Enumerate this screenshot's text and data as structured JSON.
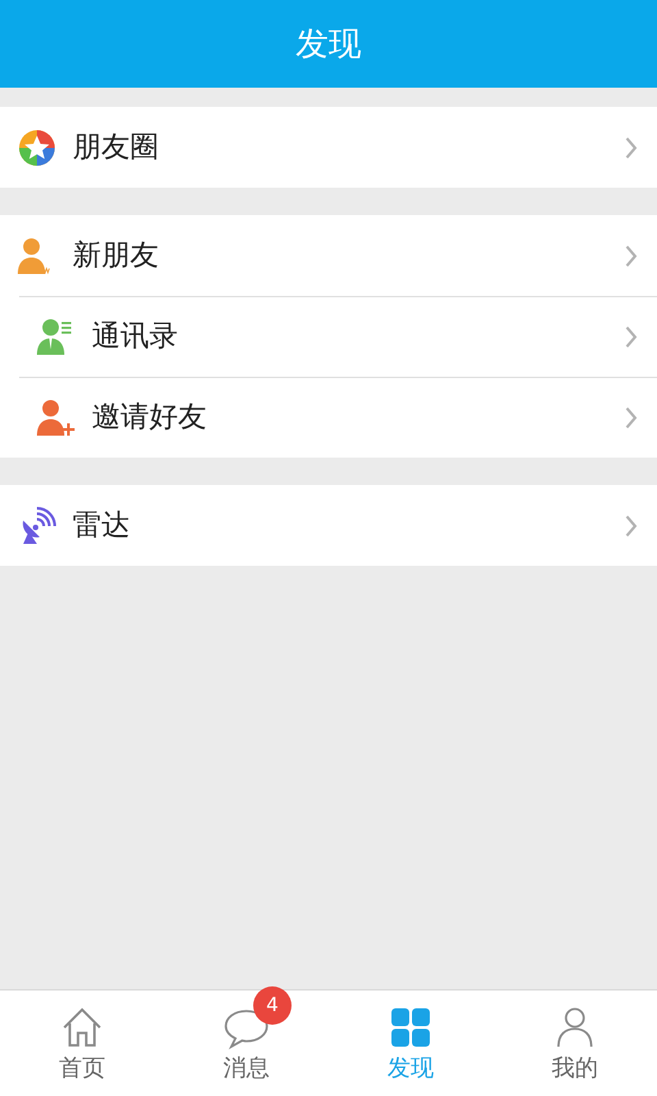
{
  "header": {
    "title": "发现"
  },
  "groups": [
    {
      "items": [
        {
          "label": "朋友圈"
        }
      ]
    },
    {
      "items": [
        {
          "label": "新朋友"
        },
        {
          "label": "通讯录"
        },
        {
          "label": "邀请好友"
        }
      ]
    },
    {
      "items": [
        {
          "label": "雷达"
        }
      ]
    }
  ],
  "tabs": [
    {
      "label": "首页",
      "selected": false
    },
    {
      "label": "消息",
      "selected": false,
      "badge": "4"
    },
    {
      "label": "发现",
      "selected": true
    },
    {
      "label": "我的",
      "selected": false
    }
  ]
}
